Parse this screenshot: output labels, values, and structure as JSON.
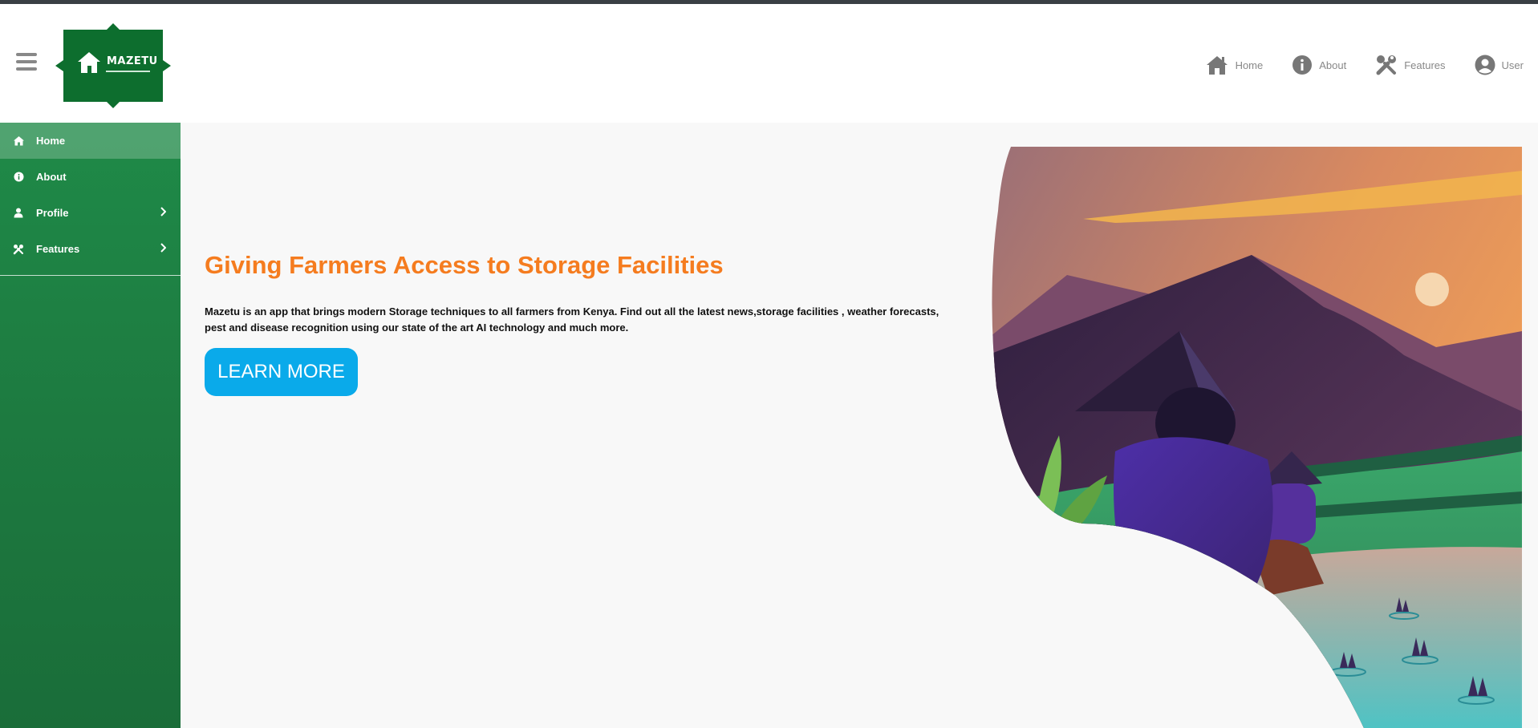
{
  "brand": {
    "name": "MAZETU",
    "logo_color": "#0d6e2e"
  },
  "topnav": {
    "items": [
      {
        "label": "Home",
        "icon": "home-icon"
      },
      {
        "label": "About",
        "icon": "info-icon"
      },
      {
        "label": "Features",
        "icon": "tools-icon"
      },
      {
        "label": "User",
        "icon": "user-circle-icon"
      }
    ]
  },
  "sidebar": {
    "items": [
      {
        "label": "Home",
        "icon": "home-icon",
        "active": true
      },
      {
        "label": "About",
        "icon": "info-icon"
      },
      {
        "label": "Profile",
        "icon": "user-icon",
        "has_submenu": true
      },
      {
        "label": "Features",
        "icon": "tools-icon",
        "has_submenu": true
      }
    ],
    "color": "#1f8a48"
  },
  "hero": {
    "title": "Giving Farmers Access to Storage Facilities",
    "description": "Mazetu is an app that brings modern Storage techniques to all farmers from Kenya. Find out all the latest news,storage facilities , weather forecasts, pest and disease recognition using our state of the art AI technology and much more.",
    "button_label": "LEARN MORE",
    "title_color": "#f57c1f",
    "button_color": "#0aaaea"
  }
}
